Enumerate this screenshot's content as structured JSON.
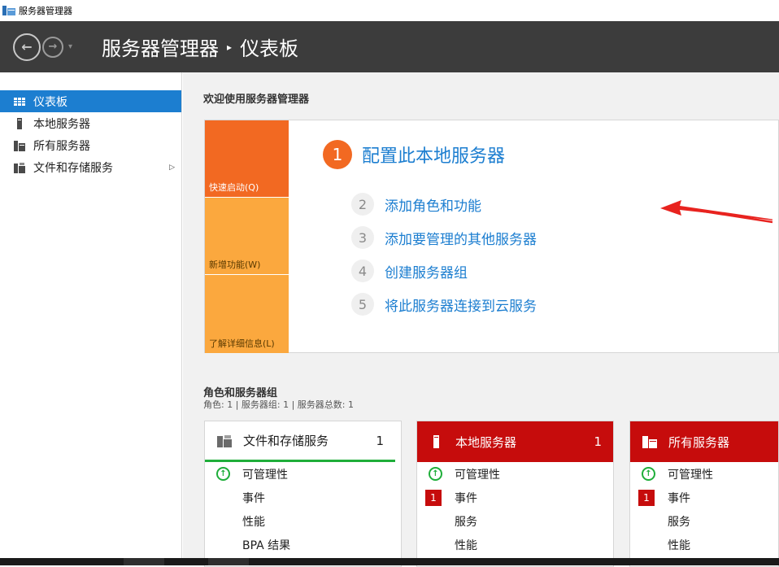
{
  "window": {
    "title": "服务器管理器"
  },
  "header": {
    "breadcrumb_root": "服务器管理器",
    "breadcrumb_separator": "▸",
    "breadcrumb_current": "仪表板"
  },
  "sidebar": {
    "items": [
      {
        "label": "仪表板",
        "icon": "dashboard-icon",
        "active": true
      },
      {
        "label": "本地服务器",
        "icon": "local-server-icon"
      },
      {
        "label": "所有服务器",
        "icon": "all-servers-icon"
      },
      {
        "label": "文件和存储服务",
        "icon": "file-storage-icon",
        "has_submenu": true
      }
    ]
  },
  "welcome": {
    "title": "欢迎使用服务器管理器"
  },
  "quick_start": {
    "tiles": [
      {
        "label": "快速启动(Q)"
      },
      {
        "label": "新增功能(W)"
      },
      {
        "label": "了解详细信息(L)"
      }
    ],
    "main_step": {
      "number": "1",
      "label": "配置此本地服务器"
    },
    "steps": [
      {
        "number": "2",
        "label": "添加角色和功能"
      },
      {
        "number": "3",
        "label": "添加要管理的其他服务器"
      },
      {
        "number": "4",
        "label": "创建服务器组"
      },
      {
        "number": "5",
        "label": "将此服务器连接到云服务"
      }
    ]
  },
  "roles": {
    "title": "角色和服务器组",
    "subtitle": "角色: 1 | 服务器组: 1 | 服务器总数: 1",
    "cards": [
      {
        "title": "文件和存储服务",
        "count": "1",
        "style": "plain",
        "rows": [
          {
            "label": "可管理性",
            "status": "ok"
          },
          {
            "label": "事件"
          },
          {
            "label": "性能"
          },
          {
            "label": "BPA 结果"
          }
        ]
      },
      {
        "title": "本地服务器",
        "count": "1",
        "style": "red",
        "rows": [
          {
            "label": "可管理性",
            "status": "ok"
          },
          {
            "label": "事件",
            "alert": "1"
          },
          {
            "label": "服务"
          },
          {
            "label": "性能"
          }
        ]
      },
      {
        "title": "所有服务器",
        "count": "",
        "style": "red",
        "rows": [
          {
            "label": "可管理性",
            "status": "ok"
          },
          {
            "label": "事件",
            "alert": "1"
          },
          {
            "label": "服务"
          },
          {
            "label": "性能"
          }
        ]
      }
    ]
  },
  "colors": {
    "accent_blue": "#1c7ed0",
    "quickstart_orange": "#f26922",
    "quickstart_amber": "#fba83e",
    "alert_red": "#c60c0c",
    "ok_green": "#1fae3a",
    "annotation_arrow": "#e8231f"
  }
}
